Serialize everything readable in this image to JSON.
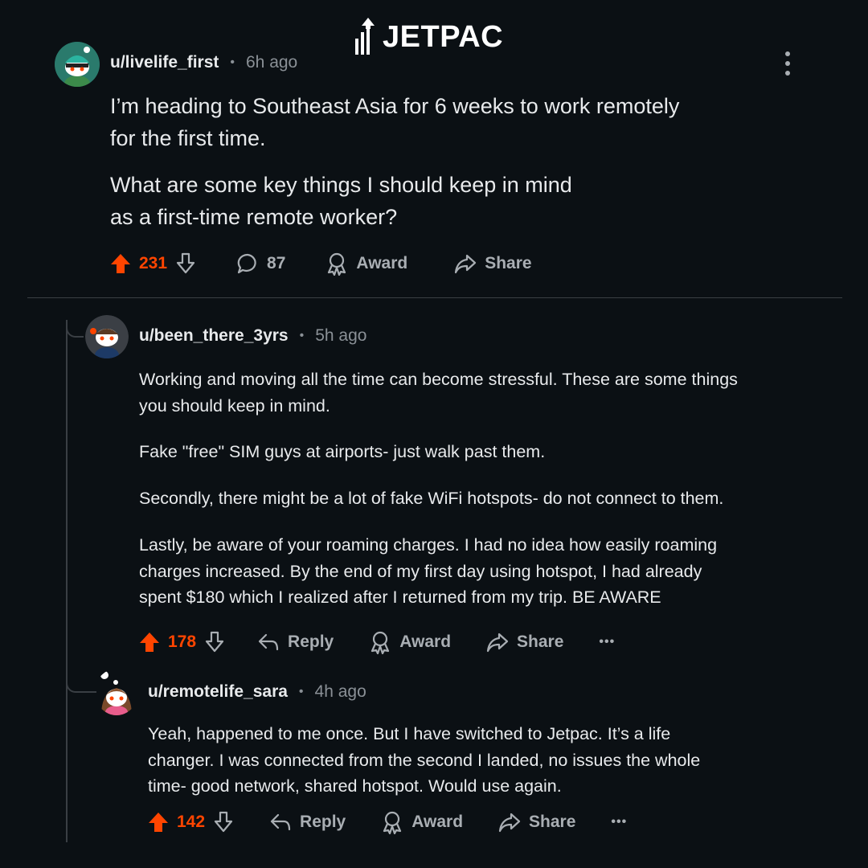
{
  "brand": {
    "name": "JETPAC"
  },
  "post": {
    "username": "u/livelife_first",
    "time": "6h ago",
    "paragraphs": [
      "I’m heading to Southeast Asia for 6 weeks to work remotely",
      "for the first time.",
      "What are some key things I should keep in mind",
      "as a first-time remote worker?"
    ],
    "upvotes": "231",
    "comments": "87",
    "award_label": "Award",
    "share_label": "Share"
  },
  "comment1": {
    "username": "u/been_there_3yrs",
    "time": "5h ago",
    "lines": [
      "Working and moving all the time can become stressful. These are some things",
      "you should keep in mind.",
      "Fake \"free\" SIM guys at airports- just walk past them.",
      "Secondly, there might be a lot of fake WiFi hotspots- do not connect to them.",
      "Lastly, be aware of your roaming charges. I had no idea how easily roaming",
      "charges increased. By the end of my first day using hotspot, I had already",
      "spent $180 which I realized after I returned from my trip. BE AWARE"
    ],
    "upvotes": "178",
    "reply_label": "Reply",
    "award_label": "Award",
    "share_label": "Share",
    "more_label": "•••"
  },
  "comment2": {
    "username": "u/remotelife_sara",
    "time": "4h ago",
    "lines": [
      "Yeah, happened to me once. But I have  switched to Jetpac. It’s a life",
      "changer. I was connected from the second I landed, no issues the whole",
      "time- good network, shared hotspot. Would use again."
    ],
    "upvotes": "142",
    "reply_label": "Reply",
    "award_label": "Award",
    "share_label": "Share",
    "more_label": "•••"
  },
  "colors": {
    "background": "#0b1014",
    "upvote": "#ff4500",
    "muted": "#a9aeb3",
    "divider": "#3a3f44"
  },
  "icons": [
    "jetpac-logo-icon",
    "upvote-arrow-icon",
    "downvote-arrow-icon",
    "comment-bubble-icon",
    "award-icon",
    "share-arrow-icon",
    "reply-arrow-icon",
    "kebab-menu-icon"
  ]
}
